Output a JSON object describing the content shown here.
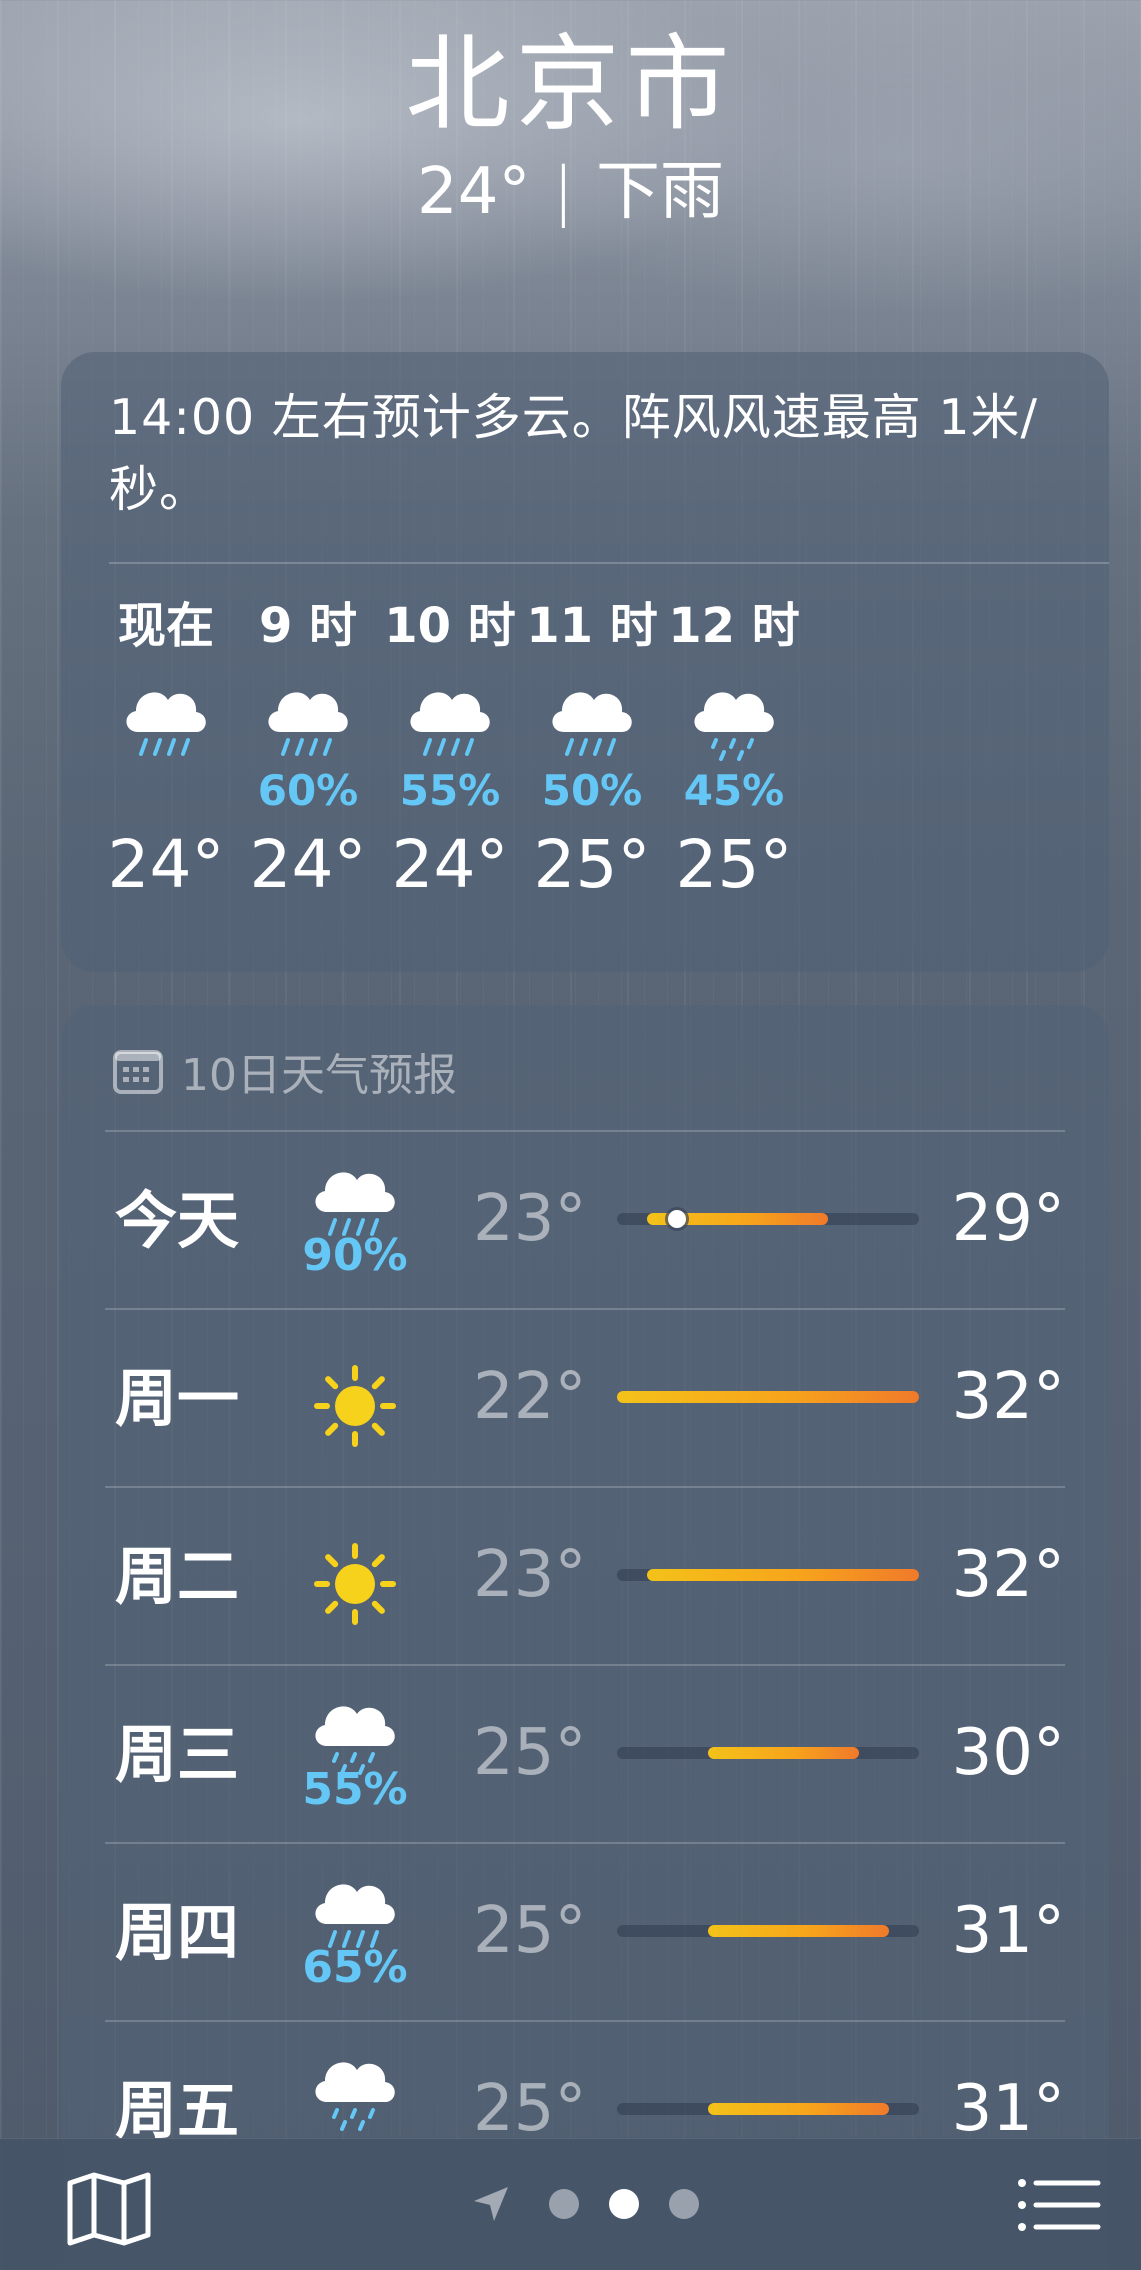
{
  "location": {
    "city": "北京市",
    "current_temp": "24°",
    "separator": "|",
    "condition": "下雨"
  },
  "hourly": {
    "summary": "14:00 左右预计多云。阵风风速最高 1米/秒。",
    "items": [
      {
        "label": "现在",
        "icon": "cloud-rain-icon",
        "pop": "",
        "temp": "24°"
      },
      {
        "label": "9 时",
        "icon": "cloud-rain-icon",
        "pop": "60%",
        "temp": "24°"
      },
      {
        "label": "10 时",
        "icon": "cloud-rain-icon",
        "pop": "55%",
        "temp": "24°"
      },
      {
        "label": "11 时",
        "icon": "cloud-rain-icon",
        "pop": "50%",
        "temp": "25°"
      },
      {
        "label": "12 时",
        "icon": "cloud-drizzle-icon",
        "pop": "45%",
        "temp": "25°"
      }
    ]
  },
  "daily": {
    "title": "10日天气预报",
    "title_icon": "calendar-icon",
    "range_min": 22,
    "range_max": 32,
    "current_temp_value": 24,
    "days": [
      {
        "name": "今天",
        "icon": "cloud-rain-icon",
        "pop": "90%",
        "low": "23°",
        "high": "29°",
        "low_value": 23,
        "high_value": 29,
        "show_now": true
      },
      {
        "name": "周一",
        "icon": "sun-icon",
        "pop": "",
        "low": "22°",
        "high": "32°",
        "low_value": 22,
        "high_value": 32,
        "show_now": false
      },
      {
        "name": "周二",
        "icon": "sun-icon",
        "pop": "",
        "low": "23°",
        "high": "32°",
        "low_value": 23,
        "high_value": 32,
        "show_now": false
      },
      {
        "name": "周三",
        "icon": "cloud-drizzle-icon",
        "pop": "55%",
        "low": "25°",
        "high": "30°",
        "low_value": 25,
        "high_value": 30,
        "show_now": false
      },
      {
        "name": "周四",
        "icon": "cloud-rain-icon",
        "pop": "65%",
        "low": "25°",
        "high": "31°",
        "low_value": 25,
        "high_value": 31,
        "show_now": false
      },
      {
        "name": "周五",
        "icon": "cloud-drizzle-icon",
        "pop": "",
        "low": "25°",
        "high": "31°",
        "low_value": 25,
        "high_value": 31,
        "show_now": false
      }
    ]
  },
  "bottom_bar": {
    "map_icon": "map-icon",
    "location_icon": "location-arrow-icon",
    "page_count": 3,
    "active_page": 2,
    "list_icon": "list-icon"
  },
  "colors": {
    "precip_blue": "#64c7f5",
    "bar_yellow": "#f4c21a",
    "bar_orange": "#f07a2a",
    "sun_yellow": "#f7d21c"
  }
}
